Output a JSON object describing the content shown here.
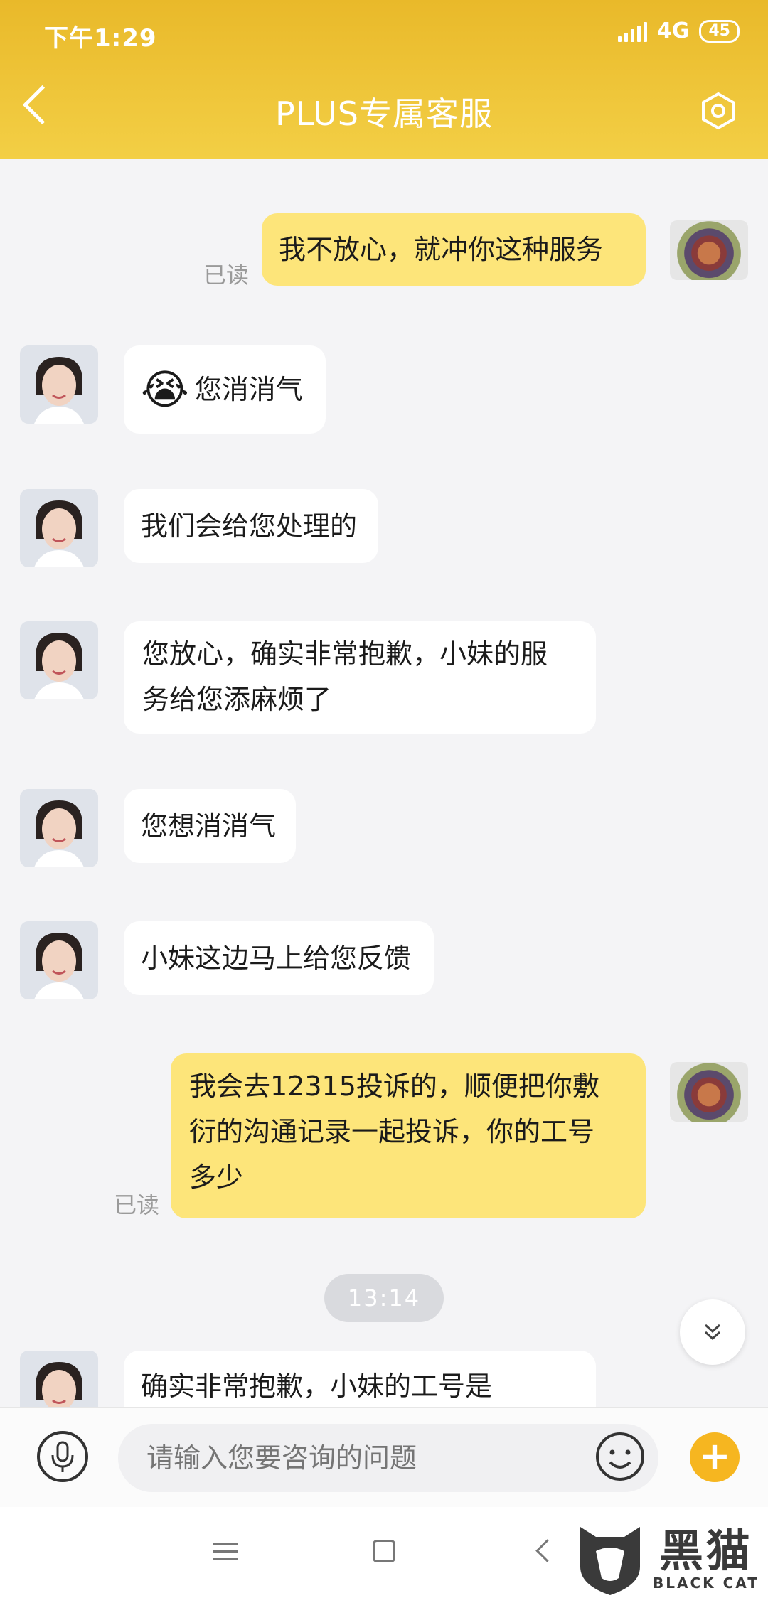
{
  "status_bar": {
    "time": "下午1:29",
    "network": "4G",
    "battery": "45"
  },
  "header": {
    "title": "PLUS专属客服"
  },
  "messages": [
    {
      "sender": "user",
      "text": "我不放心，就冲你这种服务",
      "read_label": "已读"
    },
    {
      "sender": "agent",
      "emoji": "😭",
      "text": "您消消气"
    },
    {
      "sender": "agent",
      "text": "我们会给您处理的"
    },
    {
      "sender": "agent",
      "lines": [
        "您放心，确实非常抱歉，小妹的服",
        "务给您添麻烦了"
      ]
    },
    {
      "sender": "agent",
      "text": "您想消消气"
    },
    {
      "sender": "agent",
      "text": "小妹这边马上给您反馈"
    },
    {
      "sender": "user",
      "lines": [
        "我会去12315投诉的，顺便把你敷",
        "衍的沟通记录一起投诉，你的工号",
        "多少"
      ],
      "read_label": "已读"
    },
    {
      "sender": "agent",
      "text": "确实非常抱歉，小妹的工号是"
    }
  ],
  "time_divider": "13:14",
  "input_bar": {
    "placeholder": "请输入您要咨询的问题"
  },
  "watermark": {
    "cn": "黑猫",
    "en": "BLACK CAT"
  },
  "colors": {
    "header": "#f3cf45",
    "user_bubble": "#fde57a",
    "accent": "#f6b620"
  }
}
